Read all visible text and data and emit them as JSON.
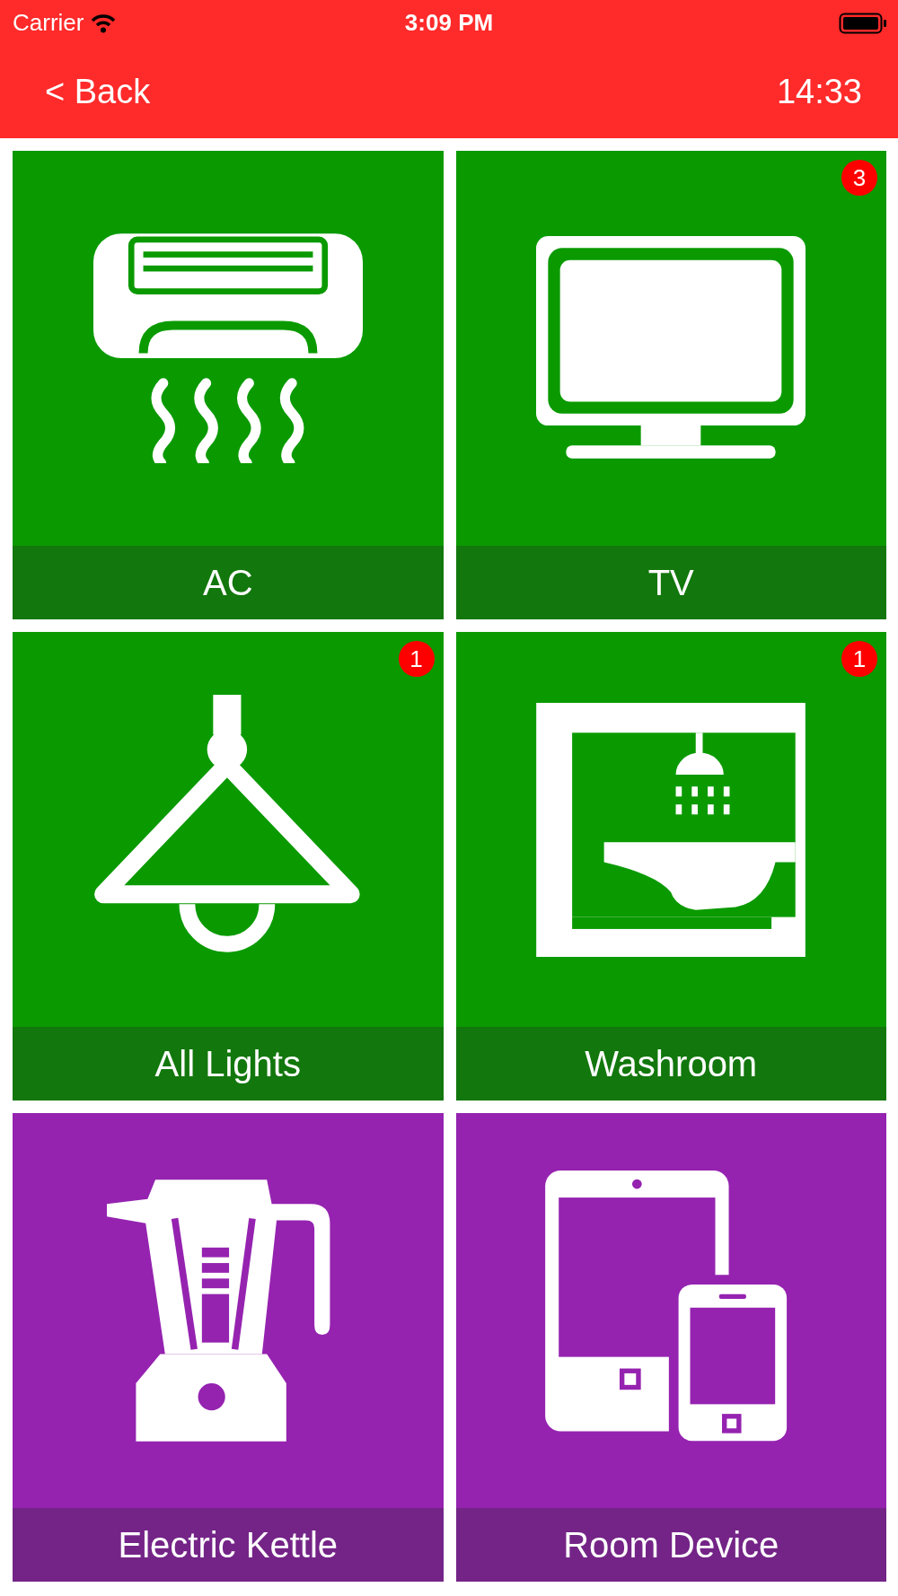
{
  "status_bar": {
    "carrier": "Carrier",
    "time": "3:09 PM"
  },
  "nav": {
    "back": "< Back",
    "clock": "14:33"
  },
  "tiles": [
    {
      "label": "AC",
      "kind": "ac",
      "color": "#0a9a00"
    },
    {
      "label": "TV",
      "kind": "tv",
      "color": "#0a9a00",
      "badge": "3"
    },
    {
      "label": "All Lights",
      "kind": "lamp",
      "color": "#0a9a00",
      "badge": "1"
    },
    {
      "label": "Washroom",
      "kind": "washroom",
      "color": "#0a9a00",
      "badge": "1"
    },
    {
      "label": "Electric Kettle",
      "kind": "blender",
      "color": "#9523b0"
    },
    {
      "label": "Room Device",
      "kind": "devices",
      "color": "#9523b0"
    }
  ]
}
